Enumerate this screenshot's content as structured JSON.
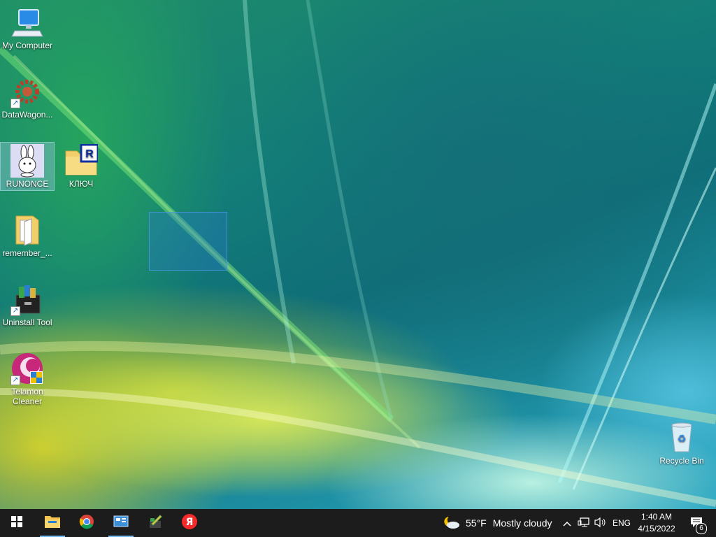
{
  "desktop": {
    "icons": [
      {
        "label": "My Computer"
      },
      {
        "label": "DataWagon..."
      },
      {
        "label": "RUNONCE"
      },
      {
        "label": "КЛЮЧ"
      },
      {
        "label": "remember_..."
      },
      {
        "label": "Uninstall Tool"
      },
      {
        "label": "Telamon Cleaner"
      },
      {
        "label": "Recycle Bin"
      }
    ]
  },
  "taskbar": {
    "pinned": [
      {
        "icon": "start-windows-icon"
      },
      {
        "icon": "file-explorer-icon"
      },
      {
        "icon": "chrome-icon"
      },
      {
        "icon": "control-panel-icon"
      },
      {
        "icon": "pencil-tool-icon"
      },
      {
        "icon": "yandex-browser-icon"
      }
    ],
    "weather": {
      "temp": "55°F",
      "condition": "Mostly cloudy"
    },
    "language": "ENG",
    "clock": {
      "time": "1:40 AM",
      "date": "4/15/2022"
    },
    "notifications": {
      "count": "6"
    }
  },
  "colors": {
    "taskbar_bg": "#1c1c1c",
    "selection": "#2878c8",
    "active_indicator": "#76b9ed"
  }
}
